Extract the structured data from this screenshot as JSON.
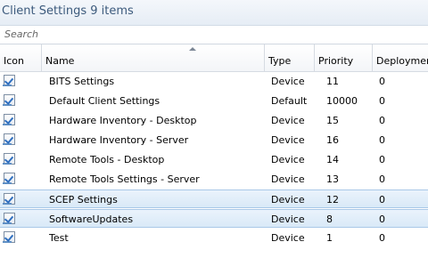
{
  "header": {
    "title": "Client Settings 9 items"
  },
  "search": {
    "placeholder": "Search"
  },
  "columns": [
    "Icon",
    "Name",
    "Type",
    "Priority",
    "Deployments"
  ],
  "rows": [
    {
      "name": "BITS Settings",
      "type": "Device",
      "priority": "11",
      "deployments": "0",
      "selected": false
    },
    {
      "name": "Default Client Settings",
      "type": "Default",
      "priority": "10000",
      "deployments": "0",
      "selected": false
    },
    {
      "name": "Hardware Inventory - Desktop",
      "type": "Device",
      "priority": "15",
      "deployments": "0",
      "selected": false
    },
    {
      "name": "Hardware Inventory - Server",
      "type": "Device",
      "priority": "16",
      "deployments": "0",
      "selected": false
    },
    {
      "name": "Remote Tools - Desktop",
      "type": "Device",
      "priority": "14",
      "deployments": "0",
      "selected": false
    },
    {
      "name": "Remote Tools Settings - Server",
      "type": "Device",
      "priority": "13",
      "deployments": "0",
      "selected": false
    },
    {
      "name": "SCEP Settings",
      "type": "Device",
      "priority": "12",
      "deployments": "0",
      "selected": true
    },
    {
      "name": "SoftwareUpdates",
      "type": "Device",
      "priority": "8",
      "deployments": "0",
      "selected": true
    },
    {
      "name": "Test",
      "type": "Device",
      "priority": "1",
      "deployments": "0",
      "selected": false
    }
  ],
  "icons": {
    "row_icon": "client-settings-icon",
    "sort": "sort-ascending-icon"
  },
  "colors": {
    "title": "#3c5a7c",
    "selected_row": "#d9e9f7",
    "selected_border": "#a9c8e8"
  }
}
